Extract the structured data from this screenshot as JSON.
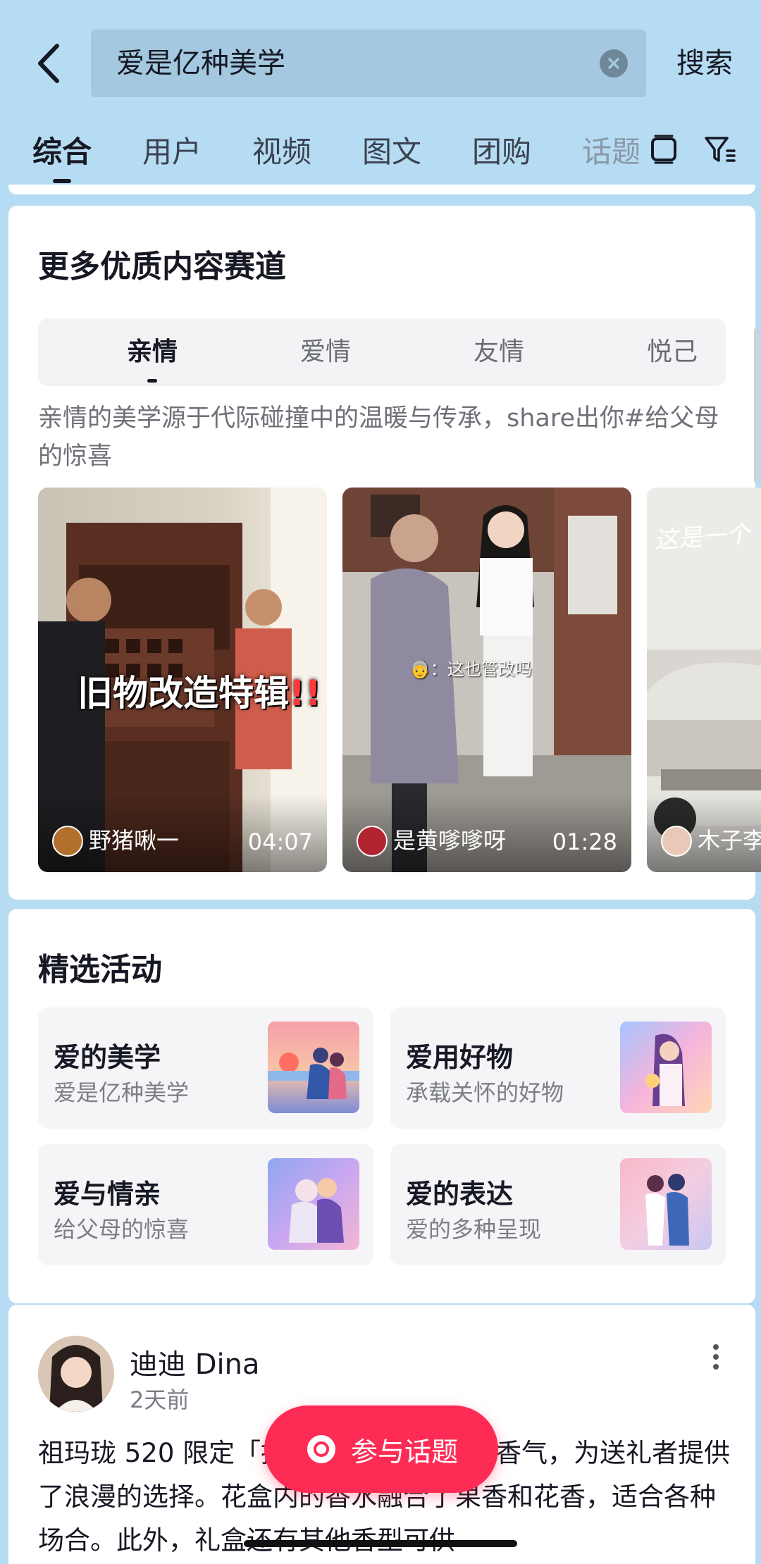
{
  "header": {
    "back_icon": "chevron-left-icon",
    "search_query": "爱是亿种美学",
    "clear_icon": "close-circle-icon",
    "search_button": "搜索",
    "tabs": [
      {
        "label": "综合",
        "active": true
      },
      {
        "label": "用户"
      },
      {
        "label": "视频"
      },
      {
        "label": "图文"
      },
      {
        "label": "团购"
      },
      {
        "label": "话题"
      }
    ],
    "layout_icon": "layout-toggle-icon",
    "filter_icon": "filter-icon"
  },
  "tracks": {
    "title": "更多优质内容赛道",
    "segments": [
      {
        "label": "亲情",
        "active": true
      },
      {
        "label": "爱情"
      },
      {
        "label": "友情"
      },
      {
        "label": "悦己"
      }
    ],
    "description": "亲情的美学源于代际碰撞中的温暖与传承，share出你#给父母的惊喜",
    "videos": [
      {
        "author": "野猪啾一",
        "duration": "04:07",
        "overlay": "旧物改造特辑",
        "overlay_mark": "!!"
      },
      {
        "author": "是黄嗲嗲呀",
        "duration": "01:28",
        "caption": "👵：这也管改吗"
      },
      {
        "author": "木子李",
        "duration": "",
        "handwriting": "这是一个 怀念"
      }
    ]
  },
  "activities": {
    "title": "精选活动",
    "items": [
      {
        "title": "爱的美学",
        "subtitle": "爱是亿种美学"
      },
      {
        "title": "爱用好物",
        "subtitle": "承载关怀的好物"
      },
      {
        "title": "爱与情亲",
        "subtitle": "给父母的惊喜"
      },
      {
        "title": "爱的表达",
        "subtitle": "爱的多种呈现"
      }
    ]
  },
  "post": {
    "author": "迪迪 Dina",
    "time": "2天前",
    "text": "祖玛珑 520 限定「推出了独特的设计和香气，为送礼者提供了浪漫的选择。花盒内的香水融合了果香和花香，适合各种场合。此外，礼盒还有其他香型可供"
  },
  "join_button": {
    "label": "参与话题",
    "icon": "camera-icon"
  },
  "colors": {
    "background": "#b6dcf3",
    "accent": "#fe2c55",
    "card": "#ffffff"
  }
}
